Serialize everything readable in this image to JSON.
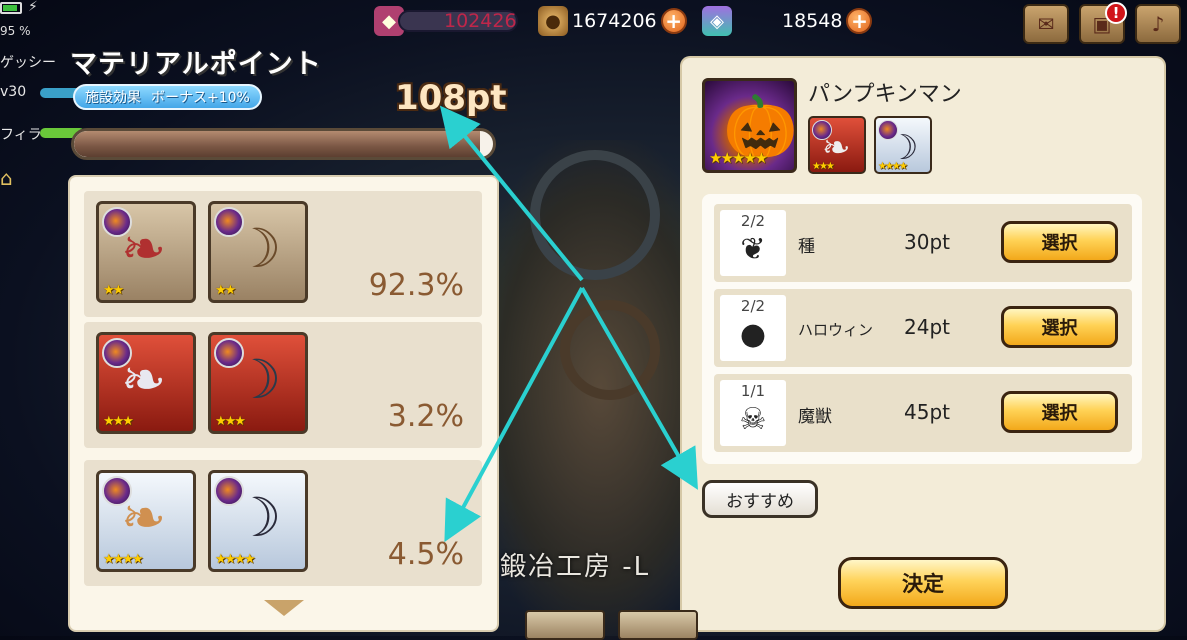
{
  "status_bar": {
    "battery_percent": "95 %"
  },
  "currencies": [
    {
      "icon": "crystal-icon",
      "value": "102426",
      "color": "#c0264a"
    },
    {
      "icon": "coin-icon",
      "value": "1674206",
      "color": "#ffffff"
    },
    {
      "icon": "gem-icon",
      "value": "18548",
      "color": "#ffffff"
    }
  ],
  "left_status": {
    "rows": [
      {
        "label": "ゲッシー"
      },
      {
        "label": "v30"
      },
      {
        "label": "フィラ"
      }
    ]
  },
  "material_point": {
    "title": "マテリアルポイント",
    "badge_label": "施設効果",
    "badge_value": "ボーナス+10%",
    "points": "108pt",
    "progress": 0.97
  },
  "rates": [
    {
      "stars": "★★",
      "rate": "92.3%",
      "tier": "bronze"
    },
    {
      "stars": "★★★",
      "rate": "3.2%",
      "tier": "red"
    },
    {
      "stars": "★★★★",
      "rate": "4.5%",
      "tier": "silver"
    }
  ],
  "background_title": "鍛冶工房 -L",
  "character": {
    "name": "パンプキンマン",
    "stars": "★★★★★",
    "equip_stars": [
      "★★★",
      "★★★★"
    ]
  },
  "materials": [
    {
      "count": "2/2",
      "name": "種",
      "points": "30pt",
      "button": "選択",
      "icon": "seed-icon"
    },
    {
      "count": "2/2",
      "name": "ハロウィン",
      "points": "24pt",
      "button": "選択",
      "icon": "halloween-icon"
    },
    {
      "count": "1/1",
      "name": "魔獣",
      "points": "45pt",
      "button": "選択",
      "icon": "beast-icon"
    }
  ],
  "buttons": {
    "recommend": "おすすめ",
    "confirm": "決定"
  }
}
